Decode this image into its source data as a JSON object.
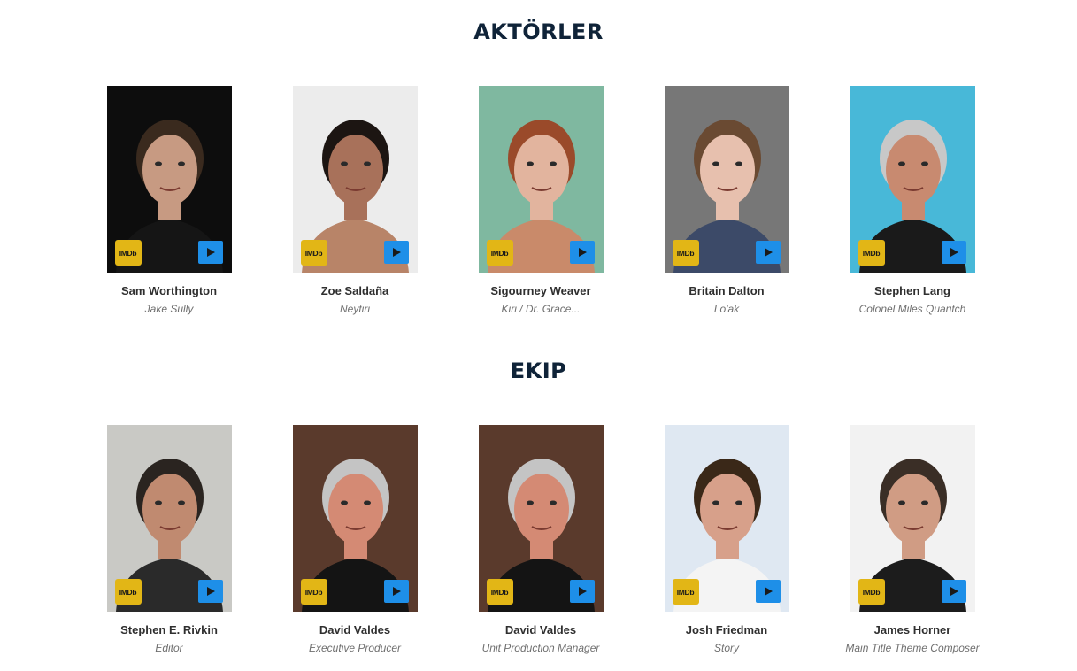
{
  "actors": {
    "title": "AKTÖRLER",
    "items": [
      {
        "name": "Sam Worthington",
        "role": "Jake Sully",
        "imdb_label": "IMDb",
        "bg": "#0d0d0d",
        "skin": "#c79a82",
        "hair": "#3a2a1e",
        "shirt": "#151515"
      },
      {
        "name": "Zoe Saldaña",
        "role": "Neytiri",
        "imdb_label": "IMDb",
        "bg": "#ececec",
        "skin": "#a8715a",
        "hair": "#1c1512",
        "shirt": "#b88468"
      },
      {
        "name": "Sigourney Weaver",
        "role": "Kiri / Dr. Grace...",
        "imdb_label": "IMDb",
        "bg": "#7fb8a0",
        "skin": "#e2b49e",
        "hair": "#9a4a2a",
        "shirt": "#c98a6a"
      },
      {
        "name": "Britain Dalton",
        "role": "Lo'ak",
        "imdb_label": "IMDb",
        "bg": "#777777",
        "skin": "#e7c0ae",
        "hair": "#6a4a32",
        "shirt": "#3c4a68"
      },
      {
        "name": "Stephen Lang",
        "role": "Colonel Miles Quaritch",
        "imdb_label": "IMDb",
        "bg": "#48b8d8",
        "skin": "#c88a70",
        "hair": "#c8c8c8",
        "shirt": "#1a1a1a"
      }
    ]
  },
  "crew": {
    "title": "EKIP",
    "items": [
      {
        "name": "Stephen E. Rivkin",
        "role": "Editor",
        "imdb_label": "IMDb",
        "bg": "#c9c9c5",
        "skin": "#c08a70",
        "hair": "#2a2420",
        "shirt": "#2a2a2a"
      },
      {
        "name": "David Valdes",
        "role": "Executive Producer",
        "imdb_label": "IMDb",
        "bg": "#5a3a2c",
        "skin": "#d48a74",
        "hair": "#c4c4c4",
        "shirt": "#141414"
      },
      {
        "name": "David Valdes",
        "role": "Unit Production Manager",
        "imdb_label": "IMDb",
        "bg": "#5a3a2c",
        "skin": "#d48a74",
        "hair": "#c4c4c4",
        "shirt": "#141414"
      },
      {
        "name": "Josh Friedman",
        "role": "Story",
        "imdb_label": "IMDb",
        "bg": "#dfe8f2",
        "skin": "#d7a08a",
        "hair": "#3a2818",
        "shirt": "#f4f4f4"
      },
      {
        "name": "James Horner",
        "role": "Main Title Theme Composer",
        "imdb_label": "IMDb",
        "bg": "#f2f2f2",
        "skin": "#d09c84",
        "hair": "#3a2e26",
        "shirt": "#1c1c1c"
      }
    ]
  }
}
